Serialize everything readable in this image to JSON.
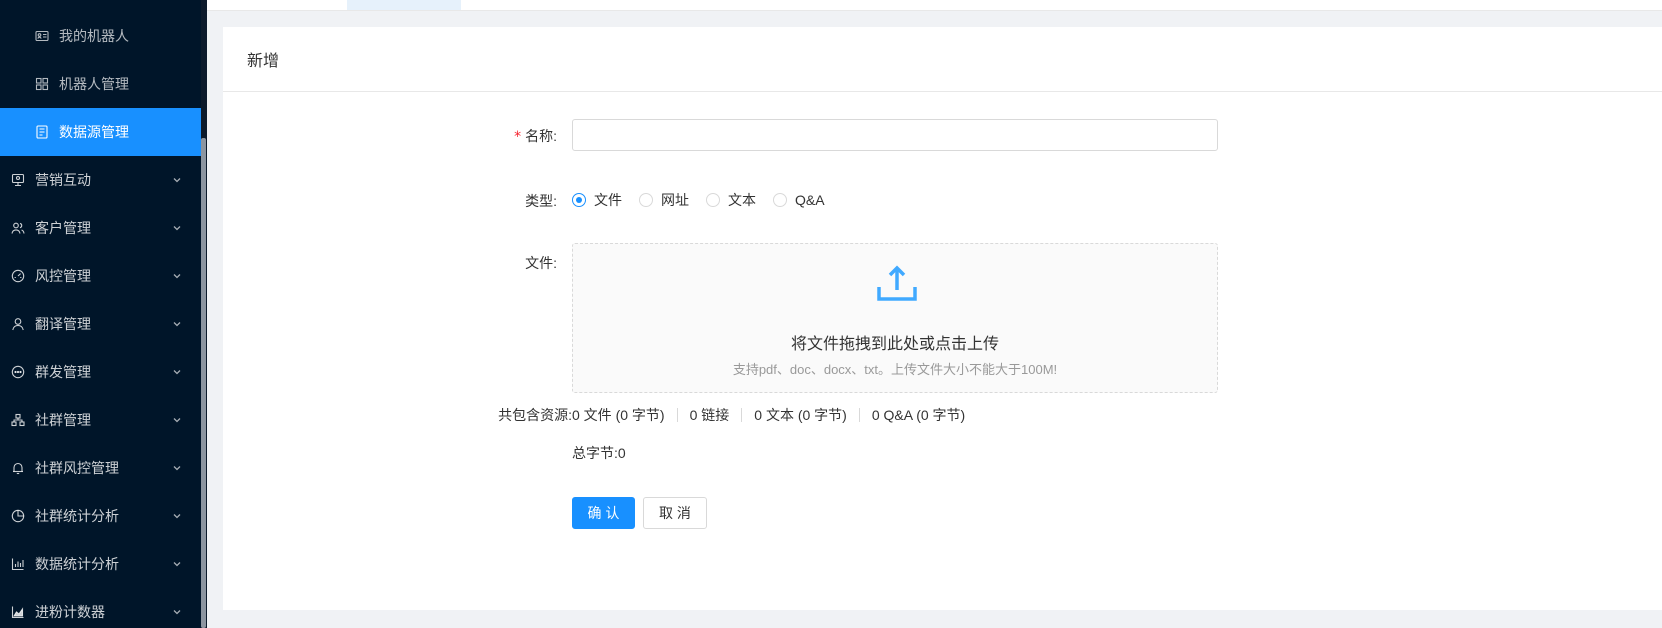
{
  "sidebar": {
    "items": [
      {
        "label": "我的机器人",
        "icon": "id-card-icon",
        "level": "sub",
        "active": false
      },
      {
        "label": "机器人管理",
        "icon": "grid-icon",
        "level": "sub",
        "active": false
      },
      {
        "label": "数据源管理",
        "icon": "document-list-icon",
        "level": "sub",
        "active": true
      },
      {
        "label": "营销互动",
        "icon": "monitor-icon",
        "level": "top",
        "active": false
      },
      {
        "label": "客户管理",
        "icon": "users-icon",
        "level": "top",
        "active": false
      },
      {
        "label": "风控管理",
        "icon": "dashboard-icon",
        "level": "top",
        "active": false
      },
      {
        "label": "翻译管理",
        "icon": "user-icon",
        "level": "top",
        "active": false
      },
      {
        "label": "群发管理",
        "icon": "chat-bubble-icon",
        "level": "top",
        "active": false
      },
      {
        "label": "社群管理",
        "icon": "cluster-icon",
        "level": "top",
        "active": false
      },
      {
        "label": "社群风控管理",
        "icon": "bell-icon",
        "level": "top",
        "active": false
      },
      {
        "label": "社群统计分析",
        "icon": "pie-chart-icon",
        "level": "top",
        "active": false
      },
      {
        "label": "数据统计分析",
        "icon": "bar-chart-icon",
        "level": "top",
        "active": false
      },
      {
        "label": "进粉计数器",
        "icon": "area-chart-icon",
        "level": "top",
        "active": false
      }
    ]
  },
  "card": {
    "title": "新增"
  },
  "form": {
    "required_mark": "*",
    "name_label": "名称:",
    "name_value": "",
    "name_placeholder": "",
    "type_label": "类型:",
    "type_options": [
      "文件",
      "网址",
      "文本",
      "Q&A"
    ],
    "type_selected": "文件",
    "file_label": "文件:",
    "upload_text": "将文件拖拽到此处或点击上传",
    "upload_hint": "支持pdf、doc、docx、txt。上传文件大小不能大于100M!",
    "resources_label": "共包含资源:",
    "resources": [
      "0 文件 (0 字节)",
      "0 链接",
      "0 文本 (0 字节)",
      "0 Q&A (0 字节)"
    ],
    "total_text": "总字节:0",
    "confirm_label": "确 认",
    "cancel_label": "取 消"
  },
  "colors": {
    "sidebar_bg": "#001529",
    "accent": "#1890ff",
    "required": "#f5222d"
  }
}
